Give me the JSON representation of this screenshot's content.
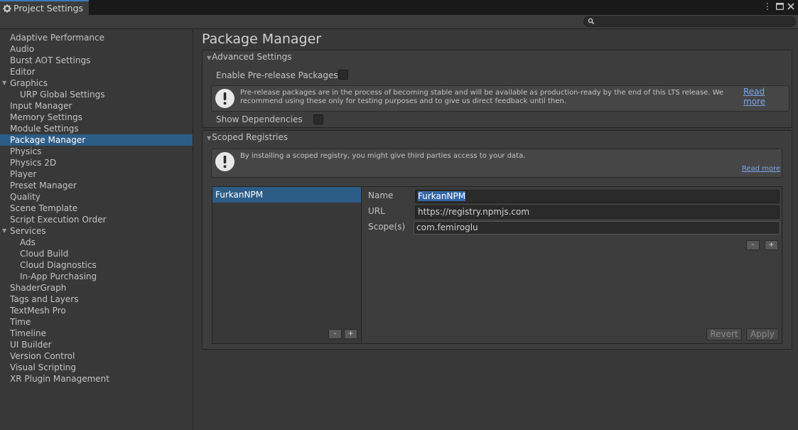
{
  "window": {
    "tab_title": "Project Settings"
  },
  "search": {
    "placeholder": ""
  },
  "sidebar": {
    "items": [
      {
        "label": "Adaptive Performance"
      },
      {
        "label": "Audio"
      },
      {
        "label": "Burst AOT Settings"
      },
      {
        "label": "Editor"
      },
      {
        "label": "Graphics"
      },
      {
        "label": "URP Global Settings"
      },
      {
        "label": "Input Manager"
      },
      {
        "label": "Memory Settings"
      },
      {
        "label": "Module Settings"
      },
      {
        "label": "Package Manager"
      },
      {
        "label": "Physics"
      },
      {
        "label": "Physics 2D"
      },
      {
        "label": "Player"
      },
      {
        "label": "Preset Manager"
      },
      {
        "label": "Quality"
      },
      {
        "label": "Scene Template"
      },
      {
        "label": "Script Execution Order"
      },
      {
        "label": "Services"
      },
      {
        "label": "Ads"
      },
      {
        "label": "Cloud Build"
      },
      {
        "label": "Cloud Diagnostics"
      },
      {
        "label": "In-App Purchasing"
      },
      {
        "label": "ShaderGraph"
      },
      {
        "label": "Tags and Layers"
      },
      {
        "label": "TextMesh Pro"
      },
      {
        "label": "Time"
      },
      {
        "label": "Timeline"
      },
      {
        "label": "UI Builder"
      },
      {
        "label": "Version Control"
      },
      {
        "label": "Visual Scripting"
      },
      {
        "label": "XR Plugin Management"
      }
    ]
  },
  "main": {
    "title": "Package Manager",
    "advanced": {
      "header": "Advanced Settings",
      "prerelease_label": "Enable Pre-release Packages",
      "prerelease_checked": false,
      "help_line1": "Pre-release packages are in the process of becoming stable and will be available as production-ready by the end of this LTS release. We",
      "help_line2": "recommend using these only for testing purposes and to give us direct feedback until then.",
      "read_more": "Read more",
      "show_deps_label": "Show Dependencies",
      "show_deps_checked": false
    },
    "scoped": {
      "header": "Scoped Registries",
      "help": "By installing a scoped registry, you might give third parties access to your data.",
      "read_more": "Read more",
      "registries": [
        {
          "name": "FurkanNPM"
        }
      ],
      "list_minus": "-",
      "list_plus": "+",
      "name_label": "Name",
      "name_value": "FurkanNPM",
      "url_label": "URL",
      "url_value": "https://registry.npmjs.com",
      "scope_label": "Scope(s)",
      "scope_value": "com.femiroglu",
      "scope_minus": "-",
      "scope_plus": "+",
      "revert": "Revert",
      "apply": "Apply"
    }
  },
  "colors": {
    "accent": "#2c5d87",
    "link": "#7aa5e8",
    "background": "#383838"
  }
}
